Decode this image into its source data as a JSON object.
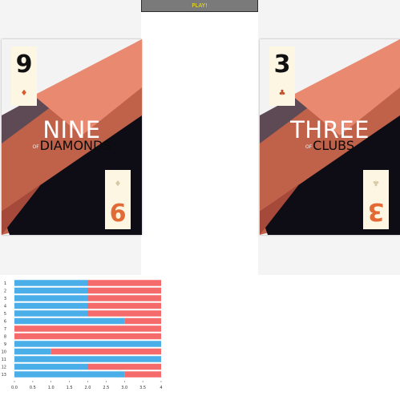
{
  "play_button": {
    "label": "PLAY!"
  },
  "cards": [
    {
      "rank": "9",
      "suit_icon": "diamond-icon",
      "suit_glyph": "♦",
      "title": "NINE",
      "of": "OF",
      "suit_name": "DIAMONDS"
    },
    {
      "rank": "3",
      "suit_icon": "club-icon",
      "suit_glyph": "♣",
      "title": "THREE",
      "of": "OF",
      "suit_name": "CLUBS"
    }
  ],
  "colors": {
    "blue": "#4aaee8",
    "red": "#f56a6a",
    "card_orange": "#c0614a",
    "card_light": "#e98a70",
    "card_dark": "#0e0d16"
  },
  "chart_data": {
    "type": "bar",
    "orientation": "horizontal",
    "stacked": true,
    "categories": [
      "1",
      "2",
      "3",
      "4",
      "5",
      "6",
      "7",
      "8",
      "9",
      "10",
      "11",
      "12",
      "13"
    ],
    "series": [
      {
        "color": "#4aaee8",
        "values": [
          2,
          2,
          2,
          2,
          2,
          3,
          0,
          0,
          4,
          1,
          4,
          2,
          3
        ]
      },
      {
        "color": "#f56a6a",
        "values": [
          2,
          2,
          2,
          2,
          2,
          1,
          4,
          4,
          0,
          3,
          0,
          2,
          1
        ]
      }
    ],
    "xlim": [
      0,
      4
    ],
    "xticks": [
      "0.0",
      "0.5",
      "1.0",
      "1.5",
      "2.0",
      "2.5",
      "3.0",
      "3.5",
      "4"
    ],
    "grid": false,
    "legend": "none"
  }
}
